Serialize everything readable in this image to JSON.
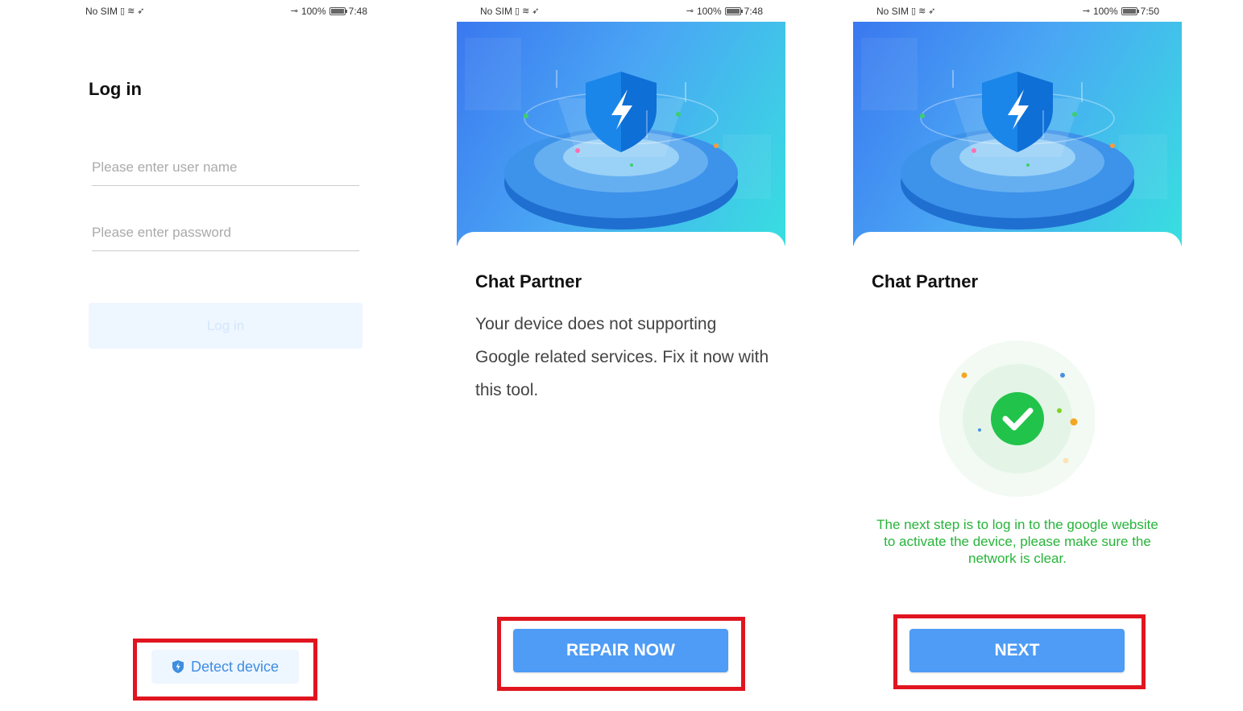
{
  "status_bars": [
    {
      "left": "No SIM",
      "battery": "100%",
      "time": "7:48"
    },
    {
      "left": "No SIM",
      "battery": "100%",
      "time": "7:48"
    },
    {
      "left": "No SIM",
      "battery": "100%",
      "time": "7:50"
    }
  ],
  "login_screen": {
    "title": "Log in",
    "username_placeholder": "Please enter user name",
    "password_placeholder": "Please enter password",
    "login_button": "Log in",
    "detect_button": "Detect device"
  },
  "repair_screen": {
    "title": "Chat Partner",
    "description": "Your device does not supporting Google related services. Fix it now with this tool.",
    "button": "REPAIR NOW"
  },
  "success_screen": {
    "title": "Chat Partner",
    "message": "The next step is to log in to the google website to activate the device, please make sure the network is clear.",
    "button": "NEXT"
  },
  "colors": {
    "primary": "#4e9cf5",
    "highlight_box": "#e0151f",
    "success": "#27b43a",
    "disabled_button": "#eef6ff"
  },
  "icons": [
    "shield-lightning-icon",
    "check-circle-icon",
    "wifi-icon",
    "key-icon",
    "battery-icon"
  ]
}
